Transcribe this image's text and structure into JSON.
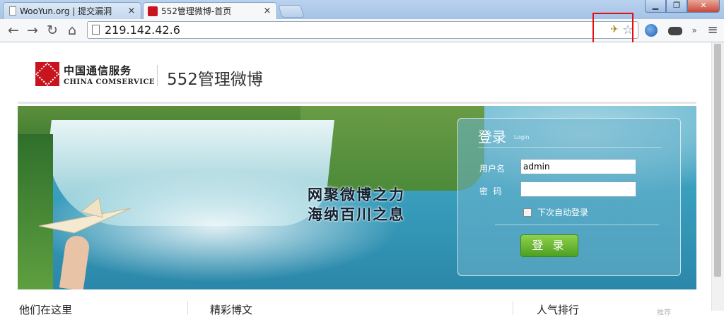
{
  "browser": {
    "tabs": [
      {
        "title": "WooYun.org | 提交漏洞",
        "close": "×"
      },
      {
        "title": "552管理微博-首页",
        "close": "×"
      }
    ],
    "window_buttons": {
      "minimize": "▁",
      "maximize": "❐",
      "close": "✕"
    },
    "nav": {
      "back": "←",
      "forward": "→",
      "reload": "↻",
      "home": "⌂"
    },
    "address": "219.142.42.6",
    "toolbar_icons": [
      "extension-icon",
      "star-icon",
      "globe-icon",
      "incognito-mask-icon",
      "overflow-chevron-icon",
      "menu-icon"
    ],
    "overflow": "»",
    "menu": "≡",
    "highlight_color": "#e01010"
  },
  "page": {
    "logo": {
      "cn": "中国通信服务",
      "en": "CHINA COMSERVICE",
      "brand_color": "#c8141e"
    },
    "site_title": "552管理微博",
    "banner": {
      "slogan_line1": "网聚微博之力",
      "slogan_line2": "海纳百川之息"
    },
    "login": {
      "title": "登录",
      "subtitle": "Login",
      "username_label": "用户名",
      "username_value": "admin",
      "password_label": "密  码",
      "password_value": "",
      "remember_label": "下次自动登录",
      "submit_label": "登 录",
      "button_color": "#4e9f22"
    },
    "sections": [
      "他们在这里",
      "精彩博文",
      "人气排行"
    ],
    "faint_text": "推荐"
  }
}
